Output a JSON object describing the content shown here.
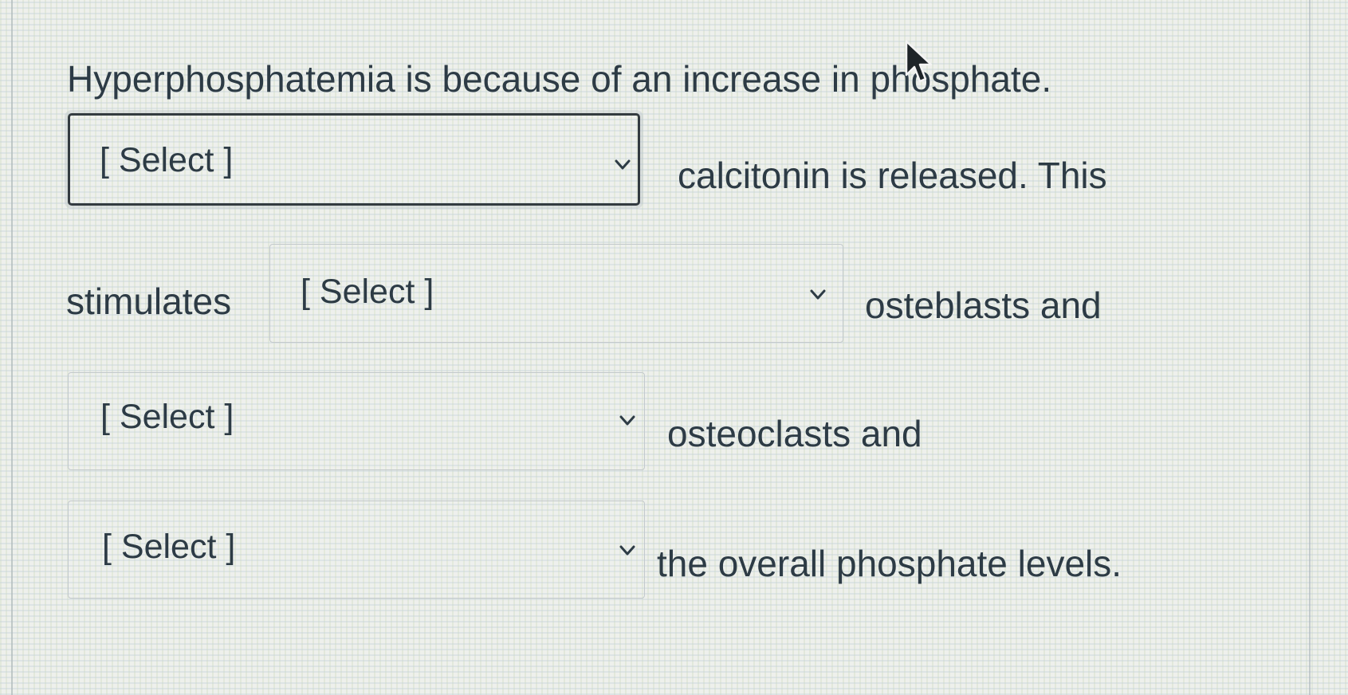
{
  "question": {
    "line1": "Hyperphosphatemia is because of an increase in phosphate.",
    "after_select_1": "calcitonin is released.  This",
    "line3_prefix": "stimulates",
    "after_select_2": "osteblasts and",
    "after_select_3": "osteoclasts and",
    "after_select_4": "the overall phosphate levels."
  },
  "dropdowns": [
    {
      "selected": "[ Select ]",
      "focused": true
    },
    {
      "selected": "[ Select ]",
      "focused": false
    },
    {
      "selected": "[ Select ]",
      "focused": false
    },
    {
      "selected": "[ Select ]",
      "focused": false
    }
  ],
  "icons": {
    "dropdown": "chevron-down-icon",
    "cursor": "mouse-pointer-icon"
  },
  "colors": {
    "text": "#2d3b45",
    "focus_border": "#333b40",
    "select_border": "#c3c9cc"
  }
}
